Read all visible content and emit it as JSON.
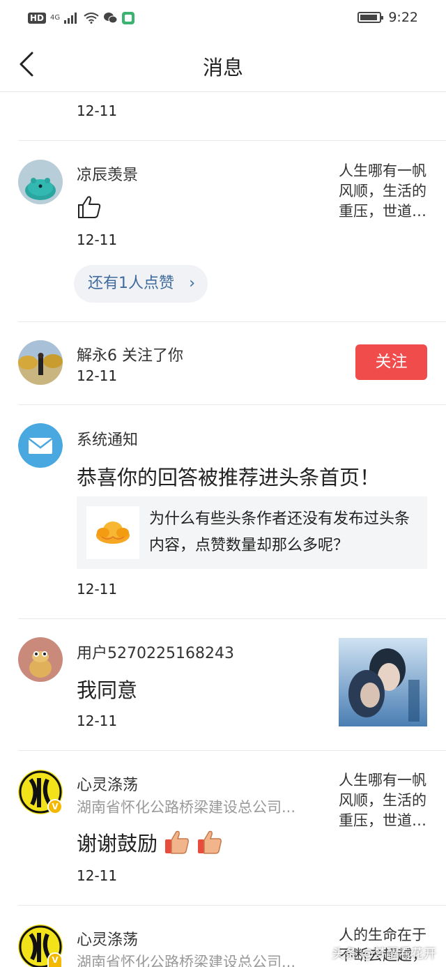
{
  "status_bar": {
    "network": "HD",
    "signal": "4G",
    "time": "9:22"
  },
  "header": {
    "title": "消息"
  },
  "notifications": [
    {
      "date": "12-11"
    },
    {
      "user": "凉辰羡景",
      "content_icon": "thumbs-up-icon",
      "date": "12-11",
      "quote": "人生哪有一帆风顺，生活的重压，世道…",
      "more_likes": "还有1人点赞"
    },
    {
      "user": "解永6",
      "action": "关注了你",
      "date": "12-11",
      "button": "关注"
    },
    {
      "user": "系统通知",
      "message": "恭喜你的回答被推荐进头条首页！",
      "card_text": "为什么有些头条作者还没有发布过头条内容，点赞数量却那么多呢？",
      "date": "12-11"
    },
    {
      "user": "用户5270225168243",
      "message": "我同意",
      "date": "12-11"
    },
    {
      "user": "心灵涤荡",
      "subtitle": "湖南省怀化公路桥梁建设总公司...",
      "message": "谢谢鼓励",
      "date": "12-11",
      "quote": "人生哪有一帆风顺，生活的重压，世道…"
    },
    {
      "user": "心灵涤荡",
      "subtitle": "湖南省怀化公路桥梁建设总公司...",
      "quote": "人的生命在于不断去超越，"
    }
  ],
  "watermark": "头条 @梦醒看花开",
  "colors": {
    "follow_button": "#f04c4c",
    "link_blue": "#3f6a9c",
    "verified_badge": "#f5b800"
  }
}
